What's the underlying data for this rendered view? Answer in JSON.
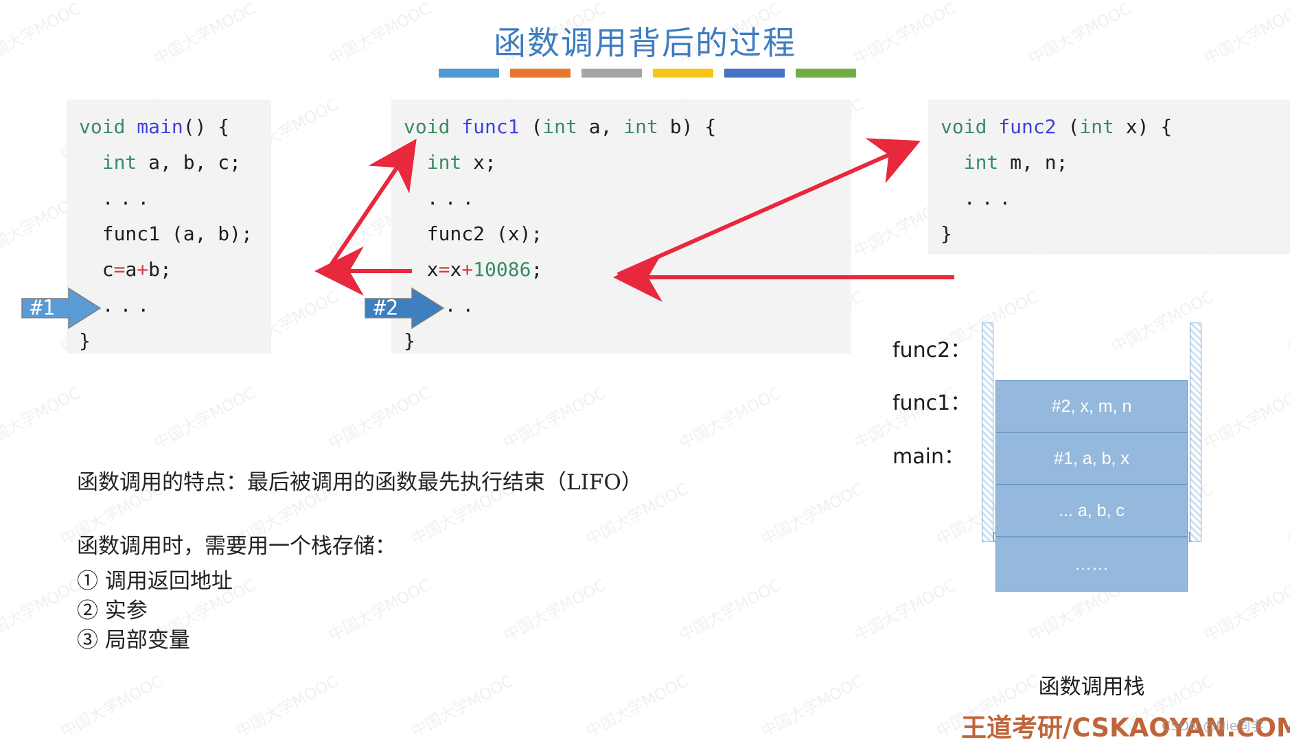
{
  "title": "函数调用背后的过程",
  "accent_bars": [
    {
      "name": "bar-blue",
      "color": "#4e9ad4"
    },
    {
      "name": "bar-orange",
      "color": "#e8762c"
    },
    {
      "name": "bar-gray",
      "color": "#a5a5a5"
    },
    {
      "name": "bar-yellow",
      "color": "#f5c518"
    },
    {
      "name": "bar-indigo",
      "color": "#4472c4"
    },
    {
      "name": "bar-green",
      "color": "#70ad47"
    }
  ],
  "code_blocks": [
    {
      "name": "main",
      "lines": [
        "void main() {",
        "  int a, b, c;",
        "  ...",
        "  func1 (a, b);",
        "  c=a+b;",
        "  ...",
        "}"
      ]
    },
    {
      "name": "func1",
      "lines": [
        "void func1 (int a, int b) {",
        "  int x;",
        "  ...",
        "  func2 (x);",
        "  x=x+10086;",
        "  ...",
        "}"
      ]
    },
    {
      "name": "func2",
      "lines": [
        "void func2 (int x) {",
        "  int m, n;",
        "  ...",
        "}"
      ]
    }
  ],
  "steps": [
    {
      "name": "step-1",
      "label": "#1"
    },
    {
      "name": "step-2",
      "label": "#2"
    }
  ],
  "notes": {
    "feature_line": "函数调用的特点：最后被调用的函数最先执行结束（LIFO）",
    "need_line": "函数调用时，需要用一个栈存储：",
    "items": [
      "① 调用返回地址",
      "② 实参",
      "③ 局部变量"
    ]
  },
  "stack": {
    "caption": "函数调用栈",
    "labels": {
      "func2": "func2：",
      "func1": "func1：",
      "main": "main："
    },
    "frames": [
      {
        "name": "frame-func2",
        "text": "#2, x, m, n"
      },
      {
        "name": "frame-func1",
        "text": "#1, a, b, x"
      },
      {
        "name": "frame-main",
        "text": "... a, b, c"
      },
      {
        "name": "frame-rest",
        "text": "……"
      }
    ]
  },
  "branding": "王道考研/CSKAOYAN.COM",
  "csdn_watermark": "CSDN @Nie同学",
  "page_watermark": "中国大学MOOC",
  "colors": {
    "title": "#3f7cc0",
    "arrow_red": "#e8283c",
    "step_blue": "#5b9bd5",
    "stack_fill": "#95b9dc",
    "brand": "#c0653a",
    "keyword_green": "#3a8a62",
    "function_blue": "#4040dd",
    "operator_red": "#d43f3f"
  }
}
